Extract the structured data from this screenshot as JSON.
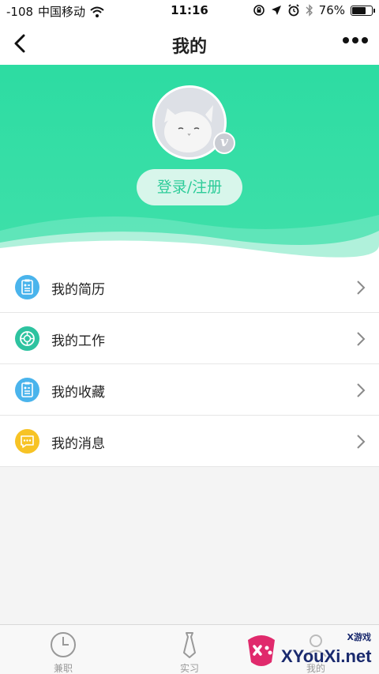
{
  "status_bar": {
    "signal": "-108",
    "carrier": "中国移动",
    "time": "11:16",
    "battery_percent": "76%",
    "battery_level": 0.76,
    "icons": [
      "wifi-icon",
      "rotation-lock-icon",
      "location-icon",
      "alarm-icon",
      "bluetooth-icon",
      "battery-icon"
    ]
  },
  "nav": {
    "title": "我的",
    "back_icon": "chevron-left-icon",
    "more_icon": "more-dots-icon"
  },
  "profile": {
    "badge": "v",
    "login_label": "登录/注册"
  },
  "menu": {
    "items": [
      {
        "label": "我的简历",
        "icon": "resume-icon",
        "color": "#4ab4ec"
      },
      {
        "label": "我的工作",
        "icon": "work-icon",
        "color": "#2ec3a0"
      },
      {
        "label": "我的收藏",
        "icon": "favorites-icon",
        "color": "#4ab4ec"
      },
      {
        "label": "我的消息",
        "icon": "message-icon",
        "color": "#f7c325"
      }
    ]
  },
  "tabs": [
    {
      "label": "兼职",
      "icon": "clock-icon"
    },
    {
      "label": "实习",
      "icon": "tie-icon"
    },
    {
      "label": "我的",
      "icon": "profile-icon"
    }
  ],
  "watermark": {
    "text": "XYouXi.net",
    "top_text": "X游戏"
  },
  "colors": {
    "accent": "#2ddca2",
    "login_text": "#2dcc99",
    "tab_text": "#999999"
  }
}
